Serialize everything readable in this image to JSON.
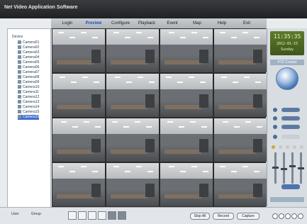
{
  "window": {
    "title": "Net Video Application Software"
  },
  "nav": {
    "tabs": [
      {
        "label": "Login"
      },
      {
        "label": "Preview",
        "active": true
      },
      {
        "label": "Configure"
      },
      {
        "label": "Playback"
      },
      {
        "label": "Event"
      },
      {
        "label": "Map"
      },
      {
        "label": "Help"
      },
      {
        "label": "Exit"
      }
    ]
  },
  "tree": {
    "root": "Device",
    "items": [
      "Camera01",
      "Camera02",
      "Camera03",
      "Camera04",
      "Camera05",
      "Camera06",
      "Camera07",
      "Camera08",
      "Camera09",
      "Camera10",
      "Camera11",
      "Camera12",
      "Camera13",
      "Camera14",
      "Camera15",
      "Camera16"
    ],
    "selected_index": 15
  },
  "clock": {
    "time": "11:35:35",
    "date": "2012-01-15",
    "day": "Sunday"
  },
  "ptz": {
    "title": "PTZ Control"
  },
  "bottom": {
    "user_label": "User",
    "group_label": "Group",
    "left_button": "Stop All",
    "record_button": "Record",
    "capture_button": "Capture"
  },
  "colors": {
    "accent": "#3f6fd1",
    "clock_bg": "#5e7a2c",
    "nav_active": "#1f4fbf"
  }
}
